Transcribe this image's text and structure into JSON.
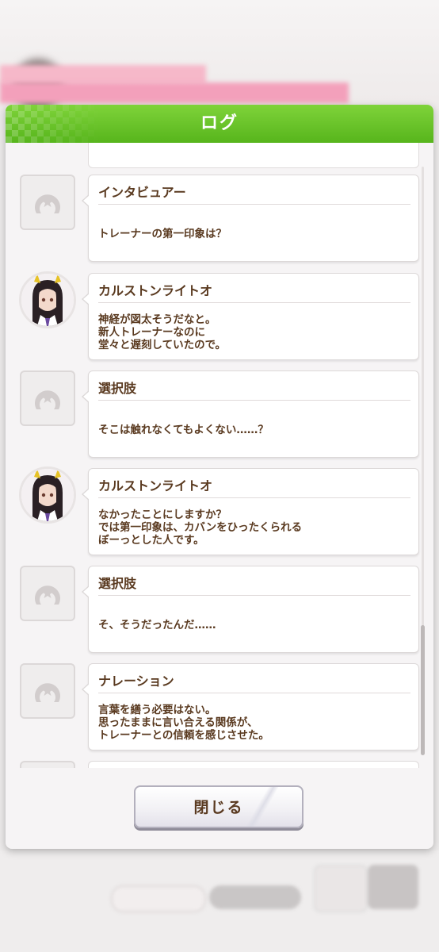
{
  "dialog": {
    "title": "ログ",
    "close_label": "閉じる"
  },
  "log": [
    {
      "speaker": "インタビュアー",
      "text": "トレーナーの第一印象は？",
      "avatar": "placeholder"
    },
    {
      "speaker": "カルストンライトオ",
      "text": "神経が図太そうだなと。\n新人トレーナーなのに\n堂々と遅刻していたので。",
      "avatar": "character"
    },
    {
      "speaker": "選択肢",
      "text": "そこは触れなくてもよくない……？",
      "avatar": "placeholder"
    },
    {
      "speaker": "カルストンライトオ",
      "text": "なかったことにしますか？\nでは第一印象は、カバンをひったくられる\nぼーっとした人です。",
      "avatar": "character"
    },
    {
      "speaker": "選択肢",
      "text": "そ、そうだったんだ……",
      "avatar": "placeholder"
    },
    {
      "speaker": "ナレーション",
      "text": "言葉を繕う必要はない。\n思ったままに言い合える関係が、\nトレーナーとの信頼を感じさせた。",
      "avatar": "placeholder"
    }
  ],
  "colors": {
    "header_green": "#57b51c",
    "text_brown": "#5a3a20"
  }
}
